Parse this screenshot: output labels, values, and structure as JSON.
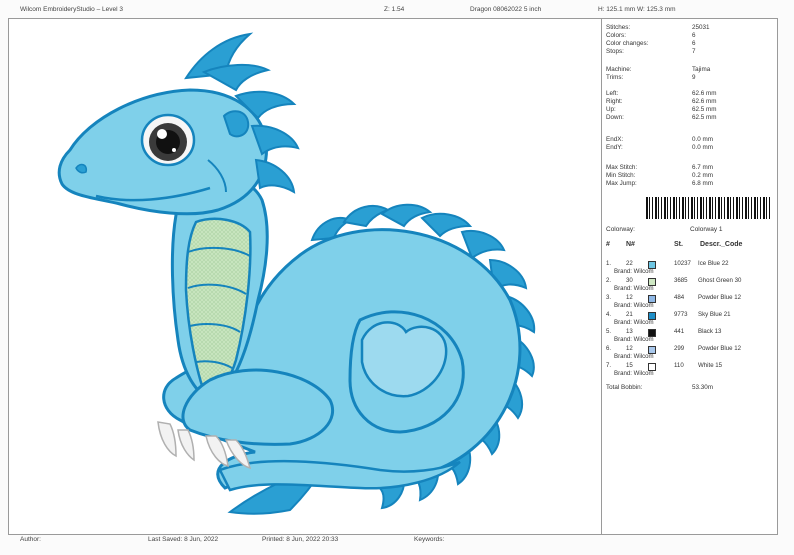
{
  "header": {
    "app_title": "Wilcom EmbroideryStudio – Level 3",
    "zoom": "Z: 1.54",
    "file_name": "Dragon 08062022 5 inch",
    "dimensions": "H: 125.1 mm   W: 125.3 mm"
  },
  "stats": [
    {
      "label": "Stitches:",
      "value": "25031"
    },
    {
      "label": "Colors:",
      "value": "6"
    },
    {
      "label": "Color changes:",
      "value": "6"
    },
    {
      "label": "Stops:",
      "value": "7"
    },
    {
      "label": "Machine:",
      "value": "Tajima"
    },
    {
      "label": "Trims:",
      "value": "9"
    },
    {
      "label": "Left:",
      "value": "62.6 mm"
    },
    {
      "label": "Right:",
      "value": "62.6 mm"
    },
    {
      "label": "Up:",
      "value": "62.5 mm"
    },
    {
      "label": "Down:",
      "value": "62.5 mm"
    },
    {
      "label": "EndX:",
      "value": "0.0 mm"
    },
    {
      "label": "EndY:",
      "value": "0.0 mm"
    },
    {
      "label": "Max Stitch:",
      "value": "6.7 mm"
    },
    {
      "label": "Min Stitch:",
      "value": "0.2 mm"
    },
    {
      "label": "Max Jump:",
      "value": "6.8 mm"
    }
  ],
  "colorway": {
    "label": "Colorway:",
    "value": "Colorway 1"
  },
  "table": {
    "headers": [
      "#",
      "N#",
      "St.",
      "Descr._Code"
    ],
    "rows": [
      {
        "num": "1.",
        "n": "22",
        "color": "#6ec6e3",
        "stitches": "10237",
        "descr": "Ice Blue 22",
        "brand": "Brand: Wilcom"
      },
      {
        "num": "2.",
        "n": "30",
        "color": "#cfe8c4",
        "stitches": "3685",
        "descr": "Ghost Green 30",
        "brand": "Brand: Wilcom"
      },
      {
        "num": "3.",
        "n": "12",
        "color": "#8fb8e6",
        "stitches": "484",
        "descr": "Powder Blue 12",
        "brand": "Brand: Wilcom"
      },
      {
        "num": "4.",
        "n": "21",
        "color": "#1f8fc8",
        "stitches": "9773",
        "descr": "Sky Blue 21",
        "brand": "Brand: Wilcom"
      },
      {
        "num": "5.",
        "n": "13",
        "color": "#111111",
        "stitches": "441",
        "descr": "Black 13",
        "brand": "Brand: Wilcom"
      },
      {
        "num": "6.",
        "n": "12",
        "color": "#a9c8ec",
        "stitches": "299",
        "descr": "Powder Blue 12",
        "brand": "Brand: Wilcom"
      },
      {
        "num": "7.",
        "n": "15",
        "color": "#ffffff",
        "stitches": "110",
        "descr": "White 15",
        "brand": "Brand: Wilcom"
      }
    ],
    "total_label": "Total Bobbin:",
    "total_value": "53.30m"
  },
  "footer": {
    "author": "Author:",
    "last_saved": "Last Saved:  8 Jun, 2022",
    "printed": "Printed:  8 Jun, 2022 20:33",
    "keywords": "Keywords:"
  }
}
